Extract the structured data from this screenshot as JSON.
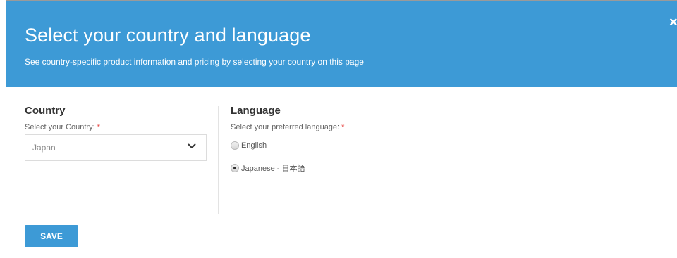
{
  "modal": {
    "title": "Select your country and language",
    "subtitle": "See country-specific product information and pricing by selecting your country on this page",
    "close_label": "×"
  },
  "country": {
    "heading": "Country",
    "label": "Select your Country:",
    "required_mark": "*",
    "selected_value": "Japan"
  },
  "language": {
    "heading": "Language",
    "label": "Select your preferred language:",
    "required_mark": "*",
    "options": [
      {
        "label": "English",
        "checked": false
      },
      {
        "label": "Japanese - 日本語",
        "checked": true
      }
    ]
  },
  "actions": {
    "save_label": "SAVE"
  },
  "colors": {
    "accent": "#3d9ad6",
    "required": "#e53935"
  }
}
